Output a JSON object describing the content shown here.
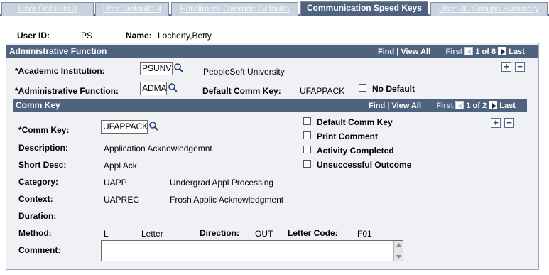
{
  "tabs": [
    {
      "label": "User Defaults 3",
      "active": false
    },
    {
      "label": "User Defaults 4",
      "active": false
    },
    {
      "label": "Enrollment Override Defaults",
      "active": false
    },
    {
      "label": "Communication Speed Keys",
      "active": true
    },
    {
      "label": "User 3C Groups Summary",
      "active": false
    }
  ],
  "user": {
    "id_label": "User ID:",
    "id_value": "PS",
    "name_label": "Name:",
    "name_value": "Locherty,Betty"
  },
  "admin": {
    "header": "Administrative Function",
    "find": "Find",
    "sep": "|",
    "view_all": "View All",
    "first": "First",
    "count": "1 of 8",
    "last": "Last",
    "institution_label": "*Academic Institution:",
    "institution_value": "PSUNV",
    "institution_desc": "PeopleSoft University",
    "function_label": "*Administrative Function:",
    "function_value": "ADMA",
    "default_key_label": "Default Comm Key:",
    "default_key_value": "UFAPPACK",
    "no_default_label": "No Default"
  },
  "comm": {
    "header": "Comm Key",
    "find": "Find",
    "sep": "|",
    "view_all": "View All",
    "first": "First",
    "count": "1 of 2",
    "last": "Last",
    "key_label": "*Comm Key:",
    "key_value": "UFAPPACK",
    "default_comm_key": "Default Comm Key",
    "print_comment": "Print Comment",
    "activity_completed": "Activity Completed",
    "unsuccessful_outcome": "Unsuccessful Outcome",
    "description_label": "Description:",
    "description_value": "Application Acknowledgemnt",
    "short_desc_label": "Short Desc:",
    "short_desc_value": "Appl Ack",
    "category_label": "Category:",
    "category_code": "UAPP",
    "category_desc": "Undergrad Appl Processing",
    "context_label": "Context:",
    "context_code": "UAPREC",
    "context_desc": "Frosh Applic Acknowledgment",
    "duration_label": "Duration:",
    "method_label": "Method:",
    "method_code": "L",
    "method_desc": "Letter",
    "direction_label": "Direction:",
    "direction_value": "OUT",
    "letter_code_label": "Letter Code:",
    "letter_code_value": "F01",
    "comment_label": "Comment:",
    "comment_value": ""
  },
  "icons": {
    "lookup": "magnifier-icon",
    "add": "plus-icon",
    "remove": "minus-icon"
  }
}
